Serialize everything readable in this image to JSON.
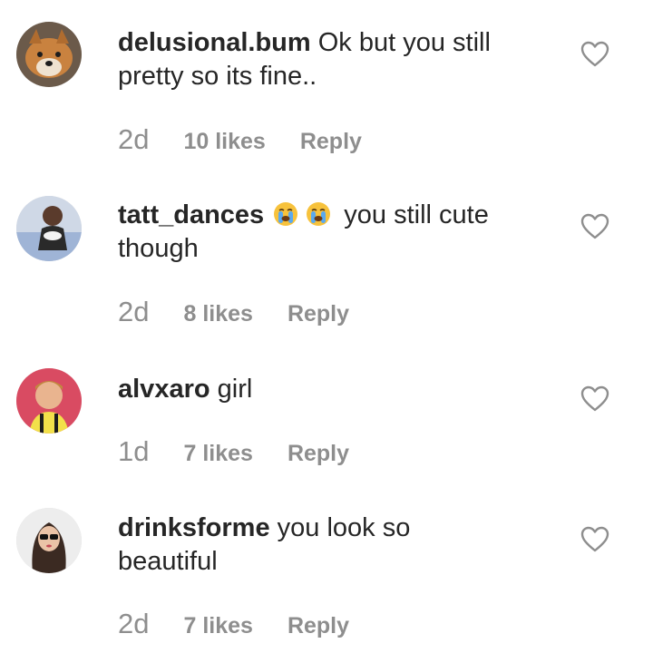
{
  "comments": [
    {
      "username": "delusional.bum",
      "text_line1": "Ok but you still",
      "text_line2": "pretty so its fine..",
      "time": "2d",
      "likes": "10 likes",
      "reply": "Reply",
      "avatar_icon": "fox-avatar"
    },
    {
      "username": "tatt_dances",
      "emojis": [
        "crying-face-emoji",
        "crying-face-emoji"
      ],
      "text_line1": "you still cute",
      "text_line2": "though",
      "time": "2d",
      "likes": "8 likes",
      "reply": "Reply",
      "avatar_icon": "person-avatar"
    },
    {
      "username": "alvxaro",
      "text_line1": "girl",
      "time": "1d",
      "likes": "7 likes",
      "reply": "Reply",
      "avatar_icon": "person-avatar"
    },
    {
      "username": "drinksforme",
      "text_line1": "you look so",
      "text_line2": "beautiful",
      "time": "2d",
      "likes": "7 likes",
      "reply": "Reply",
      "avatar_icon": "person-avatar"
    }
  ],
  "colors": {
    "text": "#262626",
    "meta": "#8e8e8e",
    "heart_outline": "#8e8e8e"
  }
}
